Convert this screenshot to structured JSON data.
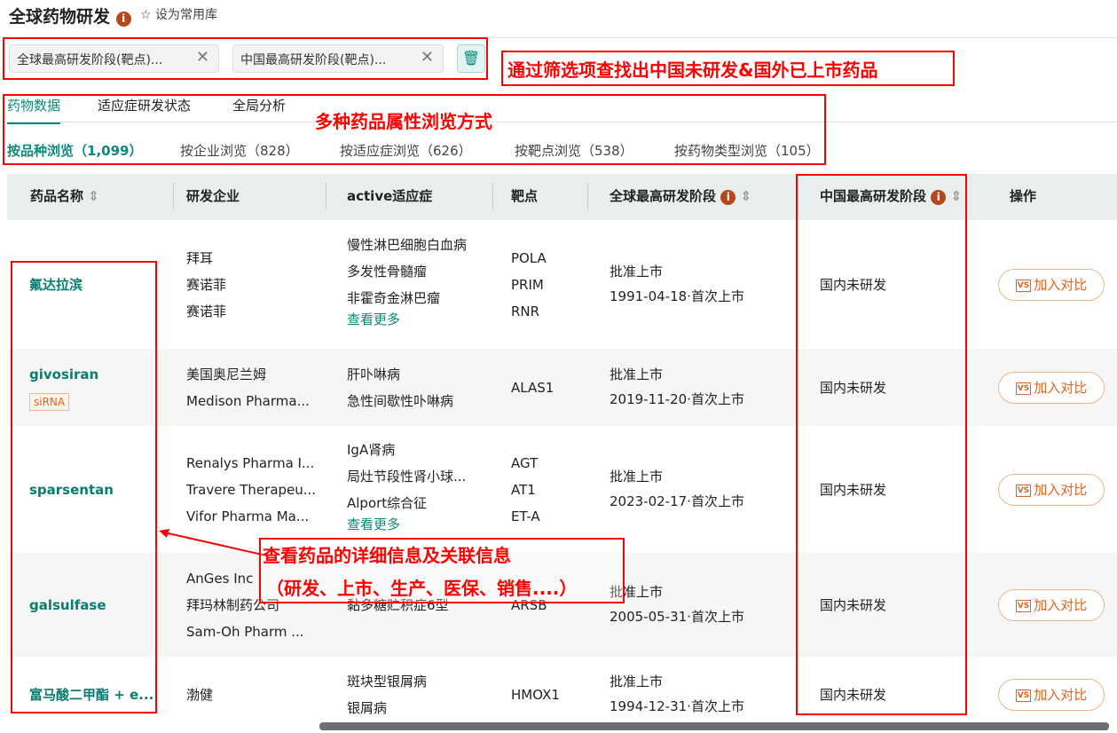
{
  "header": {
    "title": "全球药物研发",
    "favorite": "设为常用库"
  },
  "filters": [
    {
      "label": "全球最高研发阶段(靶点)..."
    },
    {
      "label": "中国最高研发阶段(靶点)..."
    }
  ],
  "tabs": [
    {
      "label": "药物数据"
    },
    {
      "label": "适应症研发状态"
    },
    {
      "label": "全局分析"
    }
  ],
  "subtabs": [
    {
      "label": "按品种浏览（1,099）"
    },
    {
      "label": "按企业浏览（828）"
    },
    {
      "label": "按适应症浏览（626）"
    },
    {
      "label": "按靶点浏览（538）"
    },
    {
      "label": "按药物类型浏览（105）"
    }
  ],
  "columns": [
    "药品名称",
    "研发企业",
    "active适应症",
    "靶点",
    "全球最高研发阶段",
    "中国最高研发阶段",
    "操作"
  ],
  "rows": [
    {
      "name": "氟达拉滨",
      "tag": null,
      "companies": [
        "拜耳",
        "赛诺菲",
        "赛诺菲"
      ],
      "indications": [
        "慢性淋巴细胞白血病",
        "多发性骨髓瘤",
        "非霍奇金淋巴瘤"
      ],
      "more": "查看更多",
      "targets": [
        "POLA",
        "PRIM",
        "RNR"
      ],
      "global_stage": "批准上市",
      "global_date": "1991-04-18·首次上市",
      "china_stage": "国内未研发",
      "action": "加入对比"
    },
    {
      "name": "givosiran",
      "tag": "siRNA",
      "companies": [
        "美国奥尼兰姆",
        "Medison Pharma..."
      ],
      "indications": [
        "肝卟啉病",
        "急性间歇性卟啉病"
      ],
      "more": null,
      "targets": [
        "ALAS1"
      ],
      "global_stage": "批准上市",
      "global_date": "2019-11-20·首次上市",
      "china_stage": "国内未研发",
      "action": "加入对比"
    },
    {
      "name": "sparsentan",
      "tag": null,
      "companies": [
        "Renalys Pharma I...",
        "Travere Therapeu...",
        "Vifor Pharma Ma..."
      ],
      "indications": [
        "IgA肾病",
        "局灶节段性肾小球...",
        "Alport综合征"
      ],
      "more": "查看更多",
      "targets": [
        "AGT",
        "AT1",
        "ET-A"
      ],
      "global_stage": "批准上市",
      "global_date": "2023-02-17·首次上市",
      "china_stage": "国内未研发",
      "action": "加入对比"
    },
    {
      "name": "galsulfase",
      "tag": null,
      "companies": [
        "AnGes Inc",
        "拜玛林制药公司",
        "Sam-Oh Pharm ..."
      ],
      "indications": [
        "黏多糖贮积症6型"
      ],
      "more": null,
      "targets": [
        "ARSB"
      ],
      "global_stage": "批准上市",
      "global_date": "2005-05-31·首次上市",
      "china_stage": "国内未研发",
      "action": "加入对比"
    },
    {
      "name": "富马酸二甲酯 + e...",
      "tag": null,
      "companies": [
        "渤健"
      ],
      "indications": [
        "斑块型银屑病",
        "银屑病"
      ],
      "more": null,
      "targets": [
        "HMOX1"
      ],
      "global_stage": "批准上市",
      "global_date": "1994-12-31·首次上市",
      "china_stage": "国内未研发",
      "action": "加入对比"
    }
  ],
  "annotations": {
    "filter_note": "通过筛选项查找出中国未研发&国外已上市药品",
    "browse_note": "多种药品属性浏览方式",
    "detail_note_1": "查看药品的详细信息及关联信息",
    "detail_note_2": "（研发、上市、生产、医保、销售....）"
  },
  "colors": {
    "accent": "#0a8a7c",
    "orange": "#e0641c",
    "annotation": "#ff0000"
  }
}
